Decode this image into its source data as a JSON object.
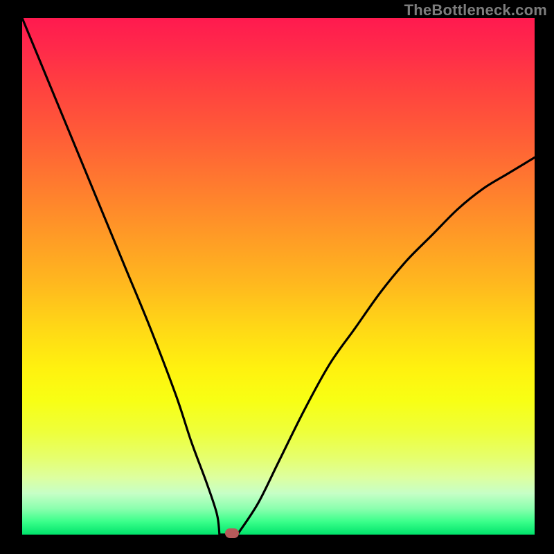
{
  "watermark": "TheBottleneck.com",
  "colors": {
    "frame": "#000000",
    "curve": "#000000",
    "marker": "#b65a5a"
  },
  "chart_data": {
    "type": "line",
    "title": "",
    "xlabel": "",
    "ylabel": "",
    "xlim": [
      0,
      100
    ],
    "ylim": [
      0,
      100
    ],
    "grid": false,
    "legend": false,
    "series": [
      {
        "name": "bottleneck-curve",
        "x": [
          0,
          5,
          10,
          15,
          20,
          25,
          30,
          33,
          36,
          38,
          40,
          41,
          42,
          46,
          50,
          55,
          60,
          65,
          70,
          75,
          80,
          85,
          90,
          95,
          100
        ],
        "values": [
          100,
          88,
          76,
          64,
          52,
          40,
          27,
          18,
          10,
          4,
          1,
          0,
          0,
          6,
          14,
          24,
          33,
          40,
          47,
          53,
          58,
          63,
          67,
          70,
          73
        ]
      }
    ],
    "flat_segment": {
      "x_start": 38.5,
      "x_end": 42,
      "y": 0
    },
    "marker": {
      "x": 41,
      "y": 0
    },
    "background_gradient": {
      "orientation": "vertical",
      "stops": [
        {
          "pos": 0.0,
          "color": "#ff1a4f"
        },
        {
          "pos": 0.22,
          "color": "#ff5a38"
        },
        {
          "pos": 0.52,
          "color": "#ffba1e"
        },
        {
          "pos": 0.68,
          "color": "#fff20f"
        },
        {
          "pos": 0.85,
          "color": "#e6ff6c"
        },
        {
          "pos": 0.95,
          "color": "#8affae"
        },
        {
          "pos": 1.0,
          "color": "#00e36b"
        }
      ]
    }
  }
}
